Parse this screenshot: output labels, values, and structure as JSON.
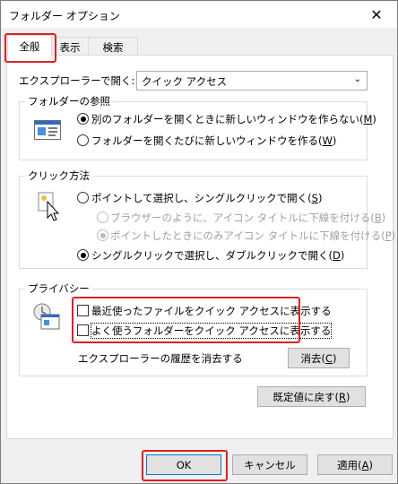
{
  "window": {
    "title": "フォルダー オプション",
    "close": "✕"
  },
  "tabs": [
    {
      "label": "全般"
    },
    {
      "label": "表示"
    },
    {
      "label": "検索"
    }
  ],
  "explorer_open": {
    "label": "エクスプローラーで開く:",
    "value": "クイック アクセス"
  },
  "folder_browse": {
    "legend": "フォルダーの参照",
    "opt1": "別のフォルダーを開くときに新しいウィンドウを作らない(",
    "opt1_key": "M",
    "opt2": "フォルダーを開くたびに新しいウィンドウを作る(",
    "opt2_key": "W"
  },
  "click_method": {
    "legend": "クリック方法",
    "opt1": "ポイントして選択し、シングルクリックで開く(",
    "opt1_key": "S",
    "sub1": "ブラウザーのように、アイコン タイトルに下線を付ける(",
    "sub1_key": "B",
    "sub2": "ポイントしたときにのみアイコン タイトルに下線を付ける(",
    "sub2_key": "P",
    "opt2": "シングルクリックで選択し、ダブルクリックで開く(",
    "opt2_key": "D"
  },
  "privacy": {
    "legend": "プライバシー",
    "check1": "最近使ったファイルをクイック アクセスに表示する",
    "check2": "よく使うフォルダーをクイック アクセスに表示する",
    "clear_label": "エクスプローラーの履歴を消去する",
    "clear_button": "消去(",
    "clear_key": "C"
  },
  "restore_button": "既定値に戻す(",
  "restore_key": "R",
  "footer": {
    "ok": "OK",
    "cancel": "キャンセル",
    "apply": "適用(",
    "apply_key": "A"
  },
  "paren_close": ")",
  "colors": {
    "highlight": "#e02020",
    "accent": "#0078d7"
  }
}
